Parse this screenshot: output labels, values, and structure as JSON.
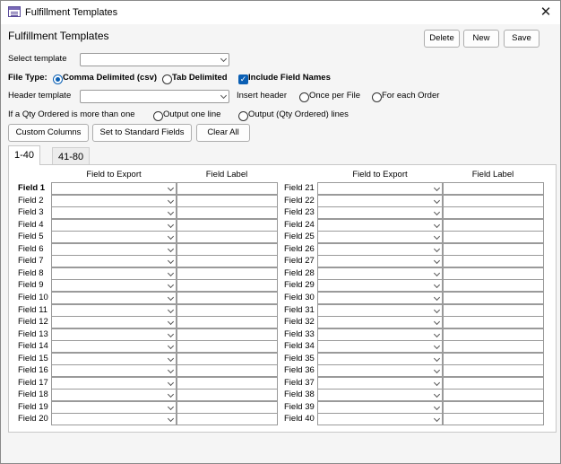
{
  "window": {
    "title": "Fulfillment Templates"
  },
  "form": {
    "heading": "Fulfillment Templates",
    "buttons": {
      "delete": "Delete",
      "new": "New",
      "save": "Save"
    },
    "select_template": {
      "label": "Select template",
      "value": ""
    },
    "file_type": {
      "label": "File Type:",
      "options": [
        "Comma Delimited (csv)",
        "Tab Delimited"
      ],
      "selected": "Comma Delimited (csv)"
    },
    "include_field_names": {
      "label": "Include Field Names",
      "checked": true
    },
    "header_template": {
      "label": "Header template",
      "value": ""
    },
    "insert_header": {
      "label": "Insert header",
      "options": [
        "Once per File",
        "For each Order"
      ],
      "selected": ""
    },
    "qty_ordered": {
      "label": "If a Qty Ordered is more than one",
      "options": [
        "Output one line",
        "Output (Qty Ordered) lines"
      ],
      "selected": ""
    },
    "action_buttons": {
      "custom_columns": "Custom Columns",
      "set_standard": "Set to Standard Fields",
      "clear_all": "Clear All"
    }
  },
  "tabs": [
    "1-40",
    "41-80"
  ],
  "grid": {
    "col_field_to_export": "Field to Export",
    "col_field_label": "Field Label",
    "left_fields": [
      "Field 1",
      "Field 2",
      "Field 3",
      "Field 4",
      "Field 5",
      "Field 6",
      "Field 7",
      "Field 8",
      "Field 9",
      "Field 10",
      "Field 11",
      "Field 12",
      "Field 13",
      "Field 14",
      "Field 15",
      "Field 16",
      "Field 17",
      "Field 18",
      "Field 19",
      "Field 20"
    ],
    "right_fields": [
      "Field 21",
      "Field 22",
      "Field 23",
      "Field 24",
      "Field 25",
      "Field 26",
      "Field 27",
      "Field 28",
      "Field 29",
      "Field 30",
      "Field 31",
      "Field 32",
      "Field 33",
      "Field 34",
      "Field 35",
      "Field 36",
      "Field 37",
      "Field 38",
      "Field 39",
      "Field 40"
    ]
  },
  "icons": {
    "app": "form-icon",
    "close": "close-icon",
    "dropdown": "chevron-down-icon"
  }
}
